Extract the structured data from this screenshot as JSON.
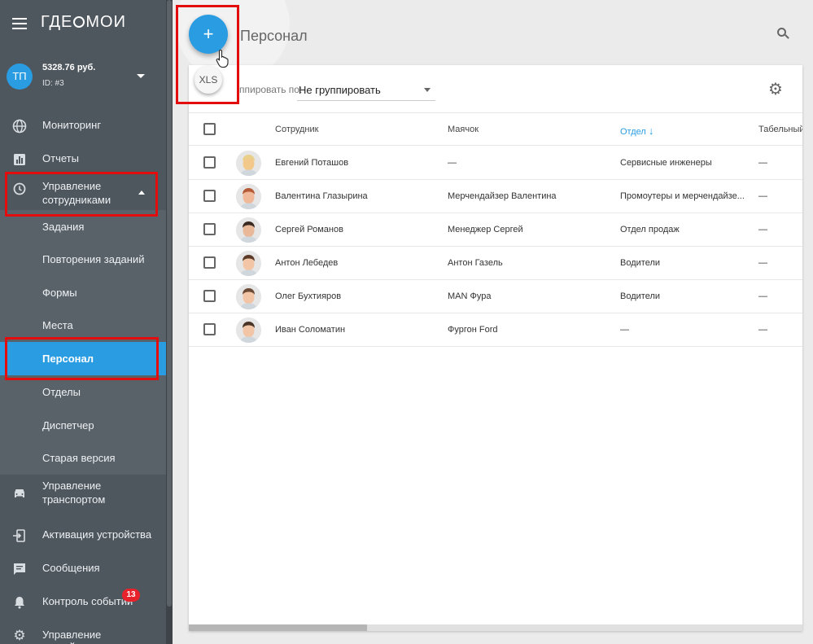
{
  "app": {
    "logo": "ГДЕМОИ",
    "logo_left": "ГДЕ",
    "logo_right": "МОИ"
  },
  "account": {
    "initials": "ТП",
    "balance": "5328.76 руб.",
    "id": "ID: #3"
  },
  "nav": {
    "monitoring": "Мониторинг",
    "reports": "Отчеты",
    "staff_mgmt": "Управление сотрудниками",
    "staff_mgmt_l1": "Управление",
    "staff_mgmt_l2": "сотрудниками",
    "sub": [
      "Задания",
      "Повторения заданий",
      "Формы",
      "Места",
      "Персонал",
      "Отделы",
      "Диспетчер",
      "Старая версия"
    ],
    "transport_l1": "Управление",
    "transport_l2": "транспортом",
    "activation": "Активация устройства",
    "messages": "Сообщения",
    "events": "Контроль событий",
    "events_badge": "13",
    "devices": "Управление устройствами"
  },
  "header": {
    "title": "Персонал"
  },
  "fab": {
    "add": "+",
    "xls": "XLS"
  },
  "toolbar": {
    "group_label": "ппировать по:",
    "group_value": "Не группировать"
  },
  "table": {
    "columns": {
      "employee": "Сотрудник",
      "beacon": "Маячок",
      "department": "Отдел",
      "tab": "Табельный"
    },
    "rows": [
      {
        "name": "Евгений Поташов",
        "beacon": "—",
        "dept": "Сервисные инженеры",
        "tab": "—"
      },
      {
        "name": "Валентина Глазырина",
        "beacon": "Мерчендайзер Валентина",
        "dept": "Промоутеры и мерчендайзе...",
        "tab": "—"
      },
      {
        "name": "Сергей Романов",
        "beacon": "Менеджер Сергей",
        "dept": "Отдел продаж",
        "tab": "—"
      },
      {
        "name": "Антон Лебедев",
        "beacon": "Антон Газель",
        "dept": "Водители",
        "tab": "—"
      },
      {
        "name": "Олег Бухтияров",
        "beacon": "MAN Фура",
        "dept": "Водители",
        "tab": "—"
      },
      {
        "name": "Иван Соломатин",
        "beacon": "Фургон Ford",
        "dept": "—",
        "tab": "—"
      }
    ]
  },
  "colors": {
    "accent": "#2a9ce2",
    "sidebar": "#4e565e",
    "highlight": "#e30d0d",
    "badge": "#e8222b"
  }
}
